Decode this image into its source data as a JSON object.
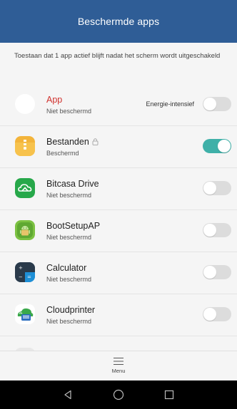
{
  "header": {
    "title": "Beschermde apps"
  },
  "description": "Toestaan dat 1 app actief blijft nadat het scherm wordt uitgeschakeld",
  "apps": [
    {
      "name": "App",
      "status": "Niet beschermd",
      "energy_label": "Energie-intensief",
      "toggle_on": false,
      "icon": "blank-app-icon"
    },
    {
      "name": "Bestanden",
      "status": "Beschermd",
      "toggle_on": true,
      "icon": "files-folder-icon",
      "locked": true
    },
    {
      "name": "Bitcasa Drive",
      "status": "Niet beschermd",
      "toggle_on": false,
      "icon": "bitcasa-cloud-icon"
    },
    {
      "name": "BootSetupAP",
      "status": "Niet beschermd",
      "toggle_on": false,
      "icon": "android-robot-icon"
    },
    {
      "name": "Calculator",
      "status": "Niet beschermd",
      "toggle_on": false,
      "icon": "calculator-icon"
    },
    {
      "name": "Cloudprinter",
      "status": "Niet beschermd",
      "toggle_on": false,
      "icon": "cloudprinter-icon"
    }
  ],
  "bottom_menu": {
    "label": "Menu"
  },
  "navigation": {
    "back": "back-triangle-icon",
    "home": "home-circle-icon",
    "recents": "recents-square-icon"
  },
  "colors": {
    "appbar": "#2f5d96",
    "toggle_on": "#3fb0a8",
    "toggle_off": "#dcdcdc",
    "alert_text": "#d0312d"
  }
}
